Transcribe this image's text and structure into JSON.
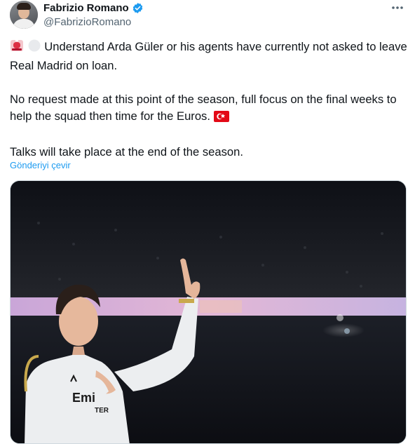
{
  "author": {
    "display_name": "Fabrizio Romano",
    "handle": "@FabrizioRomano"
  },
  "icons": {
    "verified": "verified-badge-icon",
    "more": "more-options-icon",
    "siren": "police-light-emoji",
    "circle": "white-circle-emoji",
    "flag": "turkey-flag-emoji"
  },
  "tweet": {
    "para1": "Understand Arda Güler or his agents have currently not asked to leave Real Madrid on loan.",
    "para2": "No request made at this point of the season, full focus on the final weeks to help the squad then time for the Euros.",
    "para3": "Talks will take place at the end of the season.",
    "translate_link": "Gönderiyi çevir"
  },
  "media": {
    "type": "photo",
    "jersey_text": "Emi"
  },
  "colors": {
    "link": "#1d9bf0",
    "verified": "#1d9bf0",
    "secondary_text": "#536471"
  }
}
